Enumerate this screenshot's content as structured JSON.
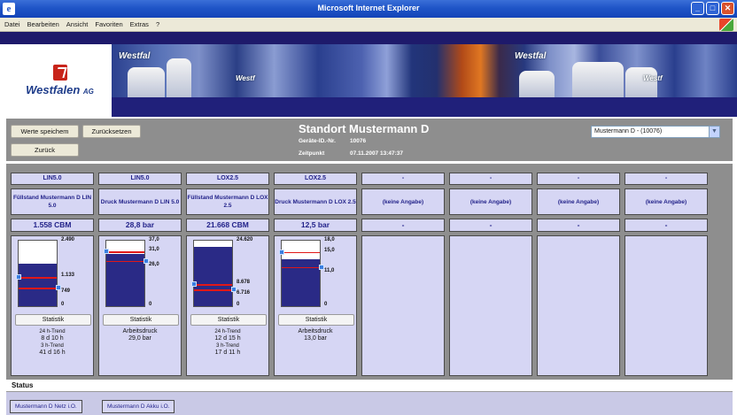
{
  "window": {
    "title": "Microsoft Internet Explorer"
  },
  "menu": [
    "Datei",
    "Bearbeiten",
    "Ansicht",
    "Favoriten",
    "Extras",
    "?"
  ],
  "logo": {
    "brand": "Westfalen",
    "suffix": "AG"
  },
  "banner": {
    "photo_logo": "Westfal",
    "photo_logo_b": "Westf"
  },
  "buttons": {
    "save": "Werte speichem",
    "reset": "Zurücksetzen",
    "back": "Zurück",
    "statistic": "Statistik"
  },
  "station": {
    "title": "Standort Mustermann D",
    "device_label": "Geräte-ID.-Nr.",
    "device_id": "10076",
    "time_label": "Zeitpunkt",
    "timestamp": "07.11.2007 13:47:37",
    "select_value": "Mustermann D - (10076)"
  },
  "columns": [
    {
      "product": "LIN5.0",
      "name": "Füllstand Mustermann D LIN 5.0",
      "value": "1.558 CBM",
      "kind": "gauge",
      "gauge": {
        "max_label": "2.490",
        "max": 2490,
        "level": 1558,
        "upper_label": "1.133",
        "upper": 1133,
        "lower_label": "749",
        "lower": 749,
        "min_label": "0"
      },
      "stats": [
        "24 h-Trend",
        "8 d 10 h",
        "3 h-Trend",
        "41 d 16 h"
      ]
    },
    {
      "product": "LIN5.0",
      "name": "Druck Mustermann D LIN 5.0",
      "value": "28,8 bar",
      "kind": "gauge",
      "gauge": {
        "max_label": "37,0",
        "max": 37,
        "level": 28.8,
        "upper_label": "31,0",
        "upper": 31,
        "lower_label": "26,0",
        "lower": 26,
        "min_label": "0"
      },
      "stats": [
        "Arbeitsdruck",
        "29,0 bar"
      ]
    },
    {
      "product": "LOX2.5",
      "name": "Füllstand Mustermann D LOX 2.5",
      "value": "21.668 CBM",
      "kind": "gauge",
      "gauge": {
        "max_label": "24.620",
        "max": 24620,
        "level": 21668,
        "upper_label": "8.678",
        "upper": 8678,
        "lower_label": "6.716",
        "lower": 6716,
        "min_label": "0"
      },
      "stats": [
        "24 h-Trend",
        "12 d 15 h",
        "3 h-Trend",
        "17 d 11 h"
      ]
    },
    {
      "product": "LOX2.5",
      "name": "Druck Mustermann D LOX 2.5",
      "value": "12,5 bar",
      "kind": "gauge",
      "gauge": {
        "max_label": "18,0",
        "max": 18,
        "level": 12.5,
        "upper_label": "15,0",
        "upper": 15,
        "lower_label": "11,0",
        "lower": 11,
        "min_label": "0"
      },
      "stats": [
        "Arbeitsdruck",
        "13,0 bar"
      ]
    },
    {
      "product": "-",
      "name": "(keine Angabe)",
      "value": "-",
      "kind": "empty",
      "stats": []
    },
    {
      "product": "-",
      "name": "(keine Angabe)",
      "value": "-",
      "kind": "empty",
      "stats": []
    },
    {
      "product": "-",
      "name": "(keine Angabe)",
      "value": "-",
      "kind": "empty",
      "stats": []
    },
    {
      "product": "-",
      "name": "(keine Angabe)",
      "value": "-",
      "kind": "empty",
      "stats": []
    }
  ],
  "status": {
    "label": "Status",
    "chips": [
      "Mustermann D Netz i.O.",
      "Mustermann D Akku i.O."
    ]
  }
}
